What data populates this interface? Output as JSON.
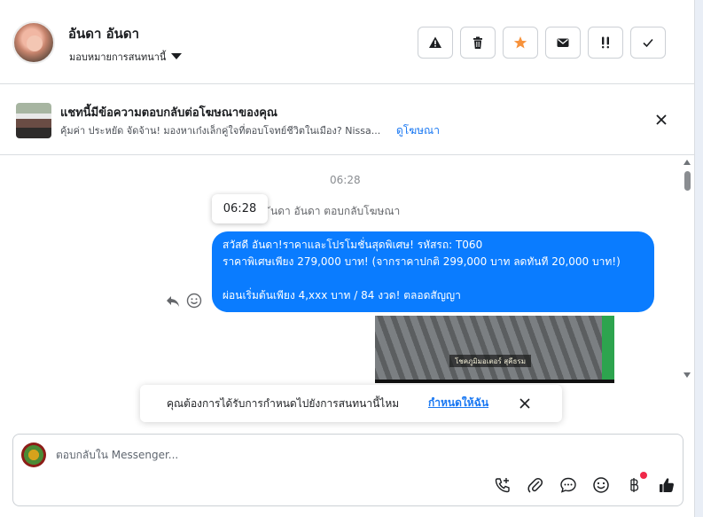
{
  "header": {
    "contact_name": "อันดา อันดา",
    "assign_label": "มอบหมายการสนทนานี้",
    "actions": [
      {
        "name": "report-spam",
        "icon": "warning-icon"
      },
      {
        "name": "delete",
        "icon": "trash-icon"
      },
      {
        "name": "star",
        "icon": "star-icon",
        "color": "#f7923b"
      },
      {
        "name": "mark-unread",
        "icon": "envelope-icon"
      },
      {
        "name": "follow-up",
        "icon": "double-exclamation-icon"
      },
      {
        "name": "mark-done",
        "icon": "check-icon"
      }
    ]
  },
  "ad_banner": {
    "title": "แชทนี้มีข้อความตอบกลับต่อโฆษณาของคุณ",
    "subtitle": "คุ้มค่า ประหยัด จัดจ้าน! มองหาเก๋งเล็กคู่ใจที่ตอบโจทย์ชีวิตในเมือง? Nissa...",
    "link": "ดูโฆษณา"
  },
  "conversation": {
    "timestamp": "06:28",
    "tooltip_time": "06:28",
    "reply_note": "ันดา อันดา ตอบกลับโฆษณา",
    "message_lines": [
      "สวัสดี อันดา!ราคาและโปรโมชั่นสุดพิเศษ! รหัสรถ: T060",
      "ราคาพิเศษเพียง 279,000 บาท! (จากราคาปกติ 299,000 บาท ลดทันที 20,000 บาท!)",
      "",
      "ผ่อนเริ่มต้นเพียง 4,xxx บาท / 84 งวด! ตลอดสัญญา"
    ],
    "media_caption": "โชคภูมิมอเตอร์ สุคีธรม"
  },
  "schedule_prompt": {
    "question": "คุณต้องการได้รับการกำหนดไปยังการสนทนานี้ไหม",
    "action": "กำหนดให้ฉัน"
  },
  "composer": {
    "placeholder": "ตอบกลับใน Messenger...",
    "tools": [
      "phone-plus-icon",
      "attachment-icon",
      "chat-bubble-icon",
      "emoji-icon",
      "baht-icon",
      "thumbs-up-icon"
    ]
  },
  "colors": {
    "accent": "#1877f2",
    "bubble": "#0a7cff",
    "star": "#f7923b"
  }
}
